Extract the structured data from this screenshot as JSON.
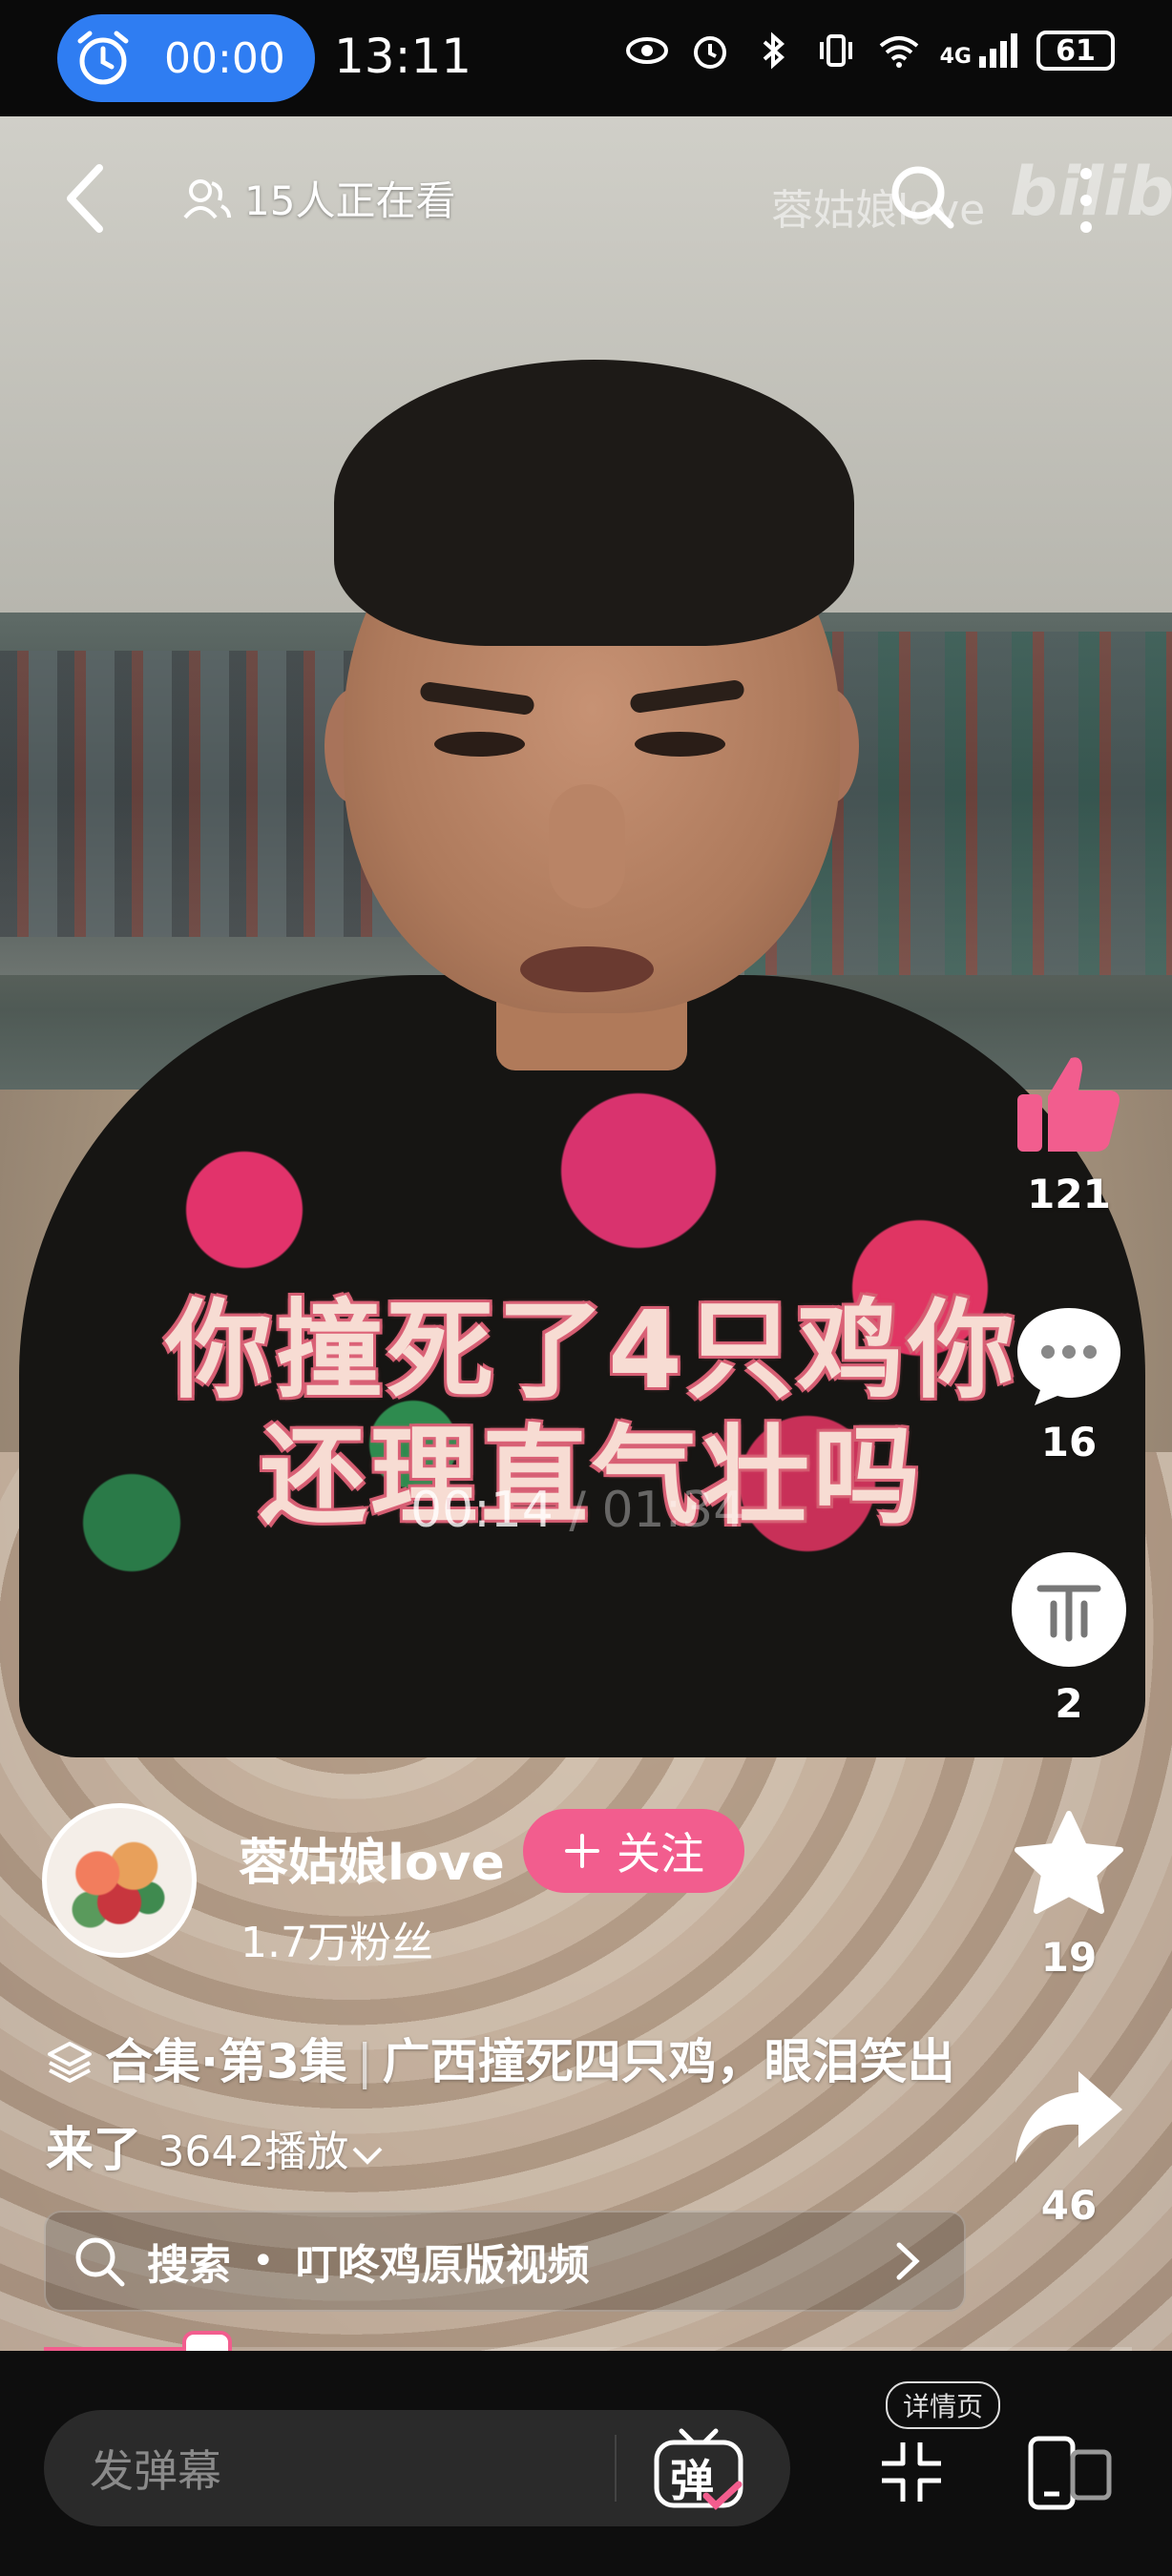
{
  "status_bar": {
    "timer": "00:00",
    "clock": "13:11",
    "network": "4G",
    "battery": "61"
  },
  "top_bar": {
    "viewers": "15人正在看",
    "watermark_user": "蓉姑娘love",
    "watermark_logo": "bilibili"
  },
  "video": {
    "subtitle_line1": "你撞死了4只鸡你",
    "subtitle_line2": "还理直气壮吗",
    "time_current": "00:14",
    "time_sep": " / ",
    "time_total": "01:34"
  },
  "actions": {
    "likes": "121",
    "comments": "16",
    "coins": "2",
    "favorites": "19",
    "shares": "46"
  },
  "author": {
    "name": "蓉姑娘love",
    "follow_label": "关注",
    "followers": "1.7万粉丝"
  },
  "description": {
    "collection": "合集",
    "episode": "·第3集",
    "title": "广西撞死四只鸡，眼泪笑出来了",
    "plays": "3642播放"
  },
  "search": {
    "label": "搜索",
    "query": "叮咚鸡原版视频"
  },
  "playback": {
    "progress": 0.15
  },
  "bottom_bar": {
    "danmaku_placeholder": "发弹幕",
    "danmaku_toggle": "弹",
    "detail_tag": "详情页"
  },
  "colors": {
    "accent": "#f25d8e",
    "timer_pill": "#2f7df2",
    "bottom_bg": "#0e0e0e"
  }
}
